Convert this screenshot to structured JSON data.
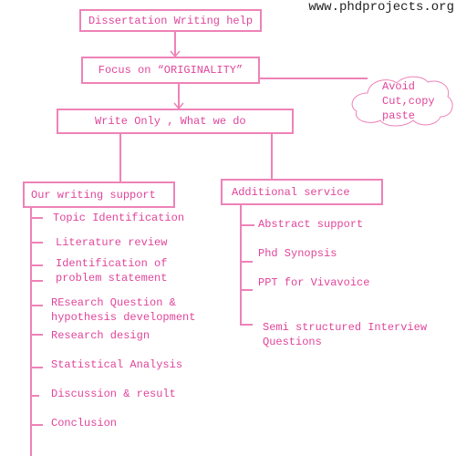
{
  "watermark": "www.phdprojects.org",
  "colors": {
    "line": "#ee82b8",
    "text": "#e0459a"
  },
  "top_box": "Dissertation Writing help",
  "focus_box": "Focus on “ORIGINALITY”",
  "cloud": {
    "lines": [
      "Avoid",
      "Cut,copy",
      "paste"
    ]
  },
  "write_box": "Write Only , What we do",
  "left_branch": {
    "title": "Our writing support",
    "items": [
      "Topic Identification",
      "Literature review",
      "Identification of\nproblem statement",
      "REsearch Question &\nhypothesis development",
      "Research design",
      "Statistical Analysis",
      "Discussion & result",
      "Conclusion"
    ]
  },
  "right_branch": {
    "title": "Additional service",
    "items": [
      "Abstract support",
      "Phd Synopsis",
      "PPT for Vivavoice",
      "Semi structured Interview\nQuestions"
    ]
  }
}
